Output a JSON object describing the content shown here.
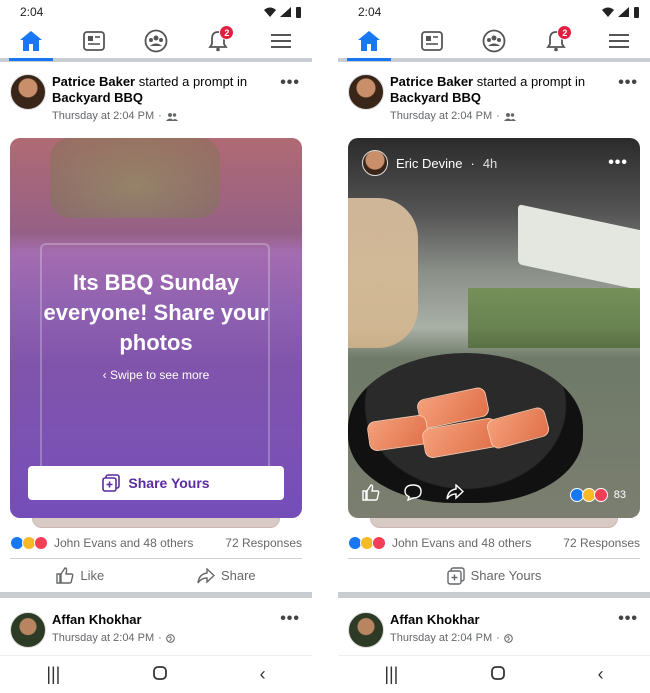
{
  "status_time": "2:04",
  "badge_count": "2",
  "left": {
    "post": {
      "author": "Patrice Baker",
      "action": "started a prompt in",
      "group": "Backyard BBQ",
      "time": "Thursday at 2:04 PM",
      "prompt_title": "Its BBQ Sunday everyone! Share your photos",
      "swipe_text": "Swipe to see more",
      "share_button": "Share Yours",
      "reactors": "John Evans and 48 others",
      "responses": "72 Responses",
      "like_label": "Like",
      "share_label": "Share"
    }
  },
  "right": {
    "post": {
      "author": "Patrice Baker",
      "action": "started a prompt in",
      "group": "Backyard BBQ",
      "time": "Thursday at 2:04 PM",
      "response_author": "Eric Devine",
      "response_time": "4h",
      "response_reaction_count": "83",
      "reactors": "John Evans and 48 others",
      "responses": "72 Responses",
      "share_yours_label": "Share Yours"
    }
  },
  "next_post": {
    "author": "Affan Khokhar",
    "time": "Thursday at 2:04 PM"
  },
  "more_glyph": "•••",
  "colors": {
    "accent": "#1877f2",
    "prompt_purple": "#5a2ca0",
    "badge_red": "#e41e3f"
  }
}
